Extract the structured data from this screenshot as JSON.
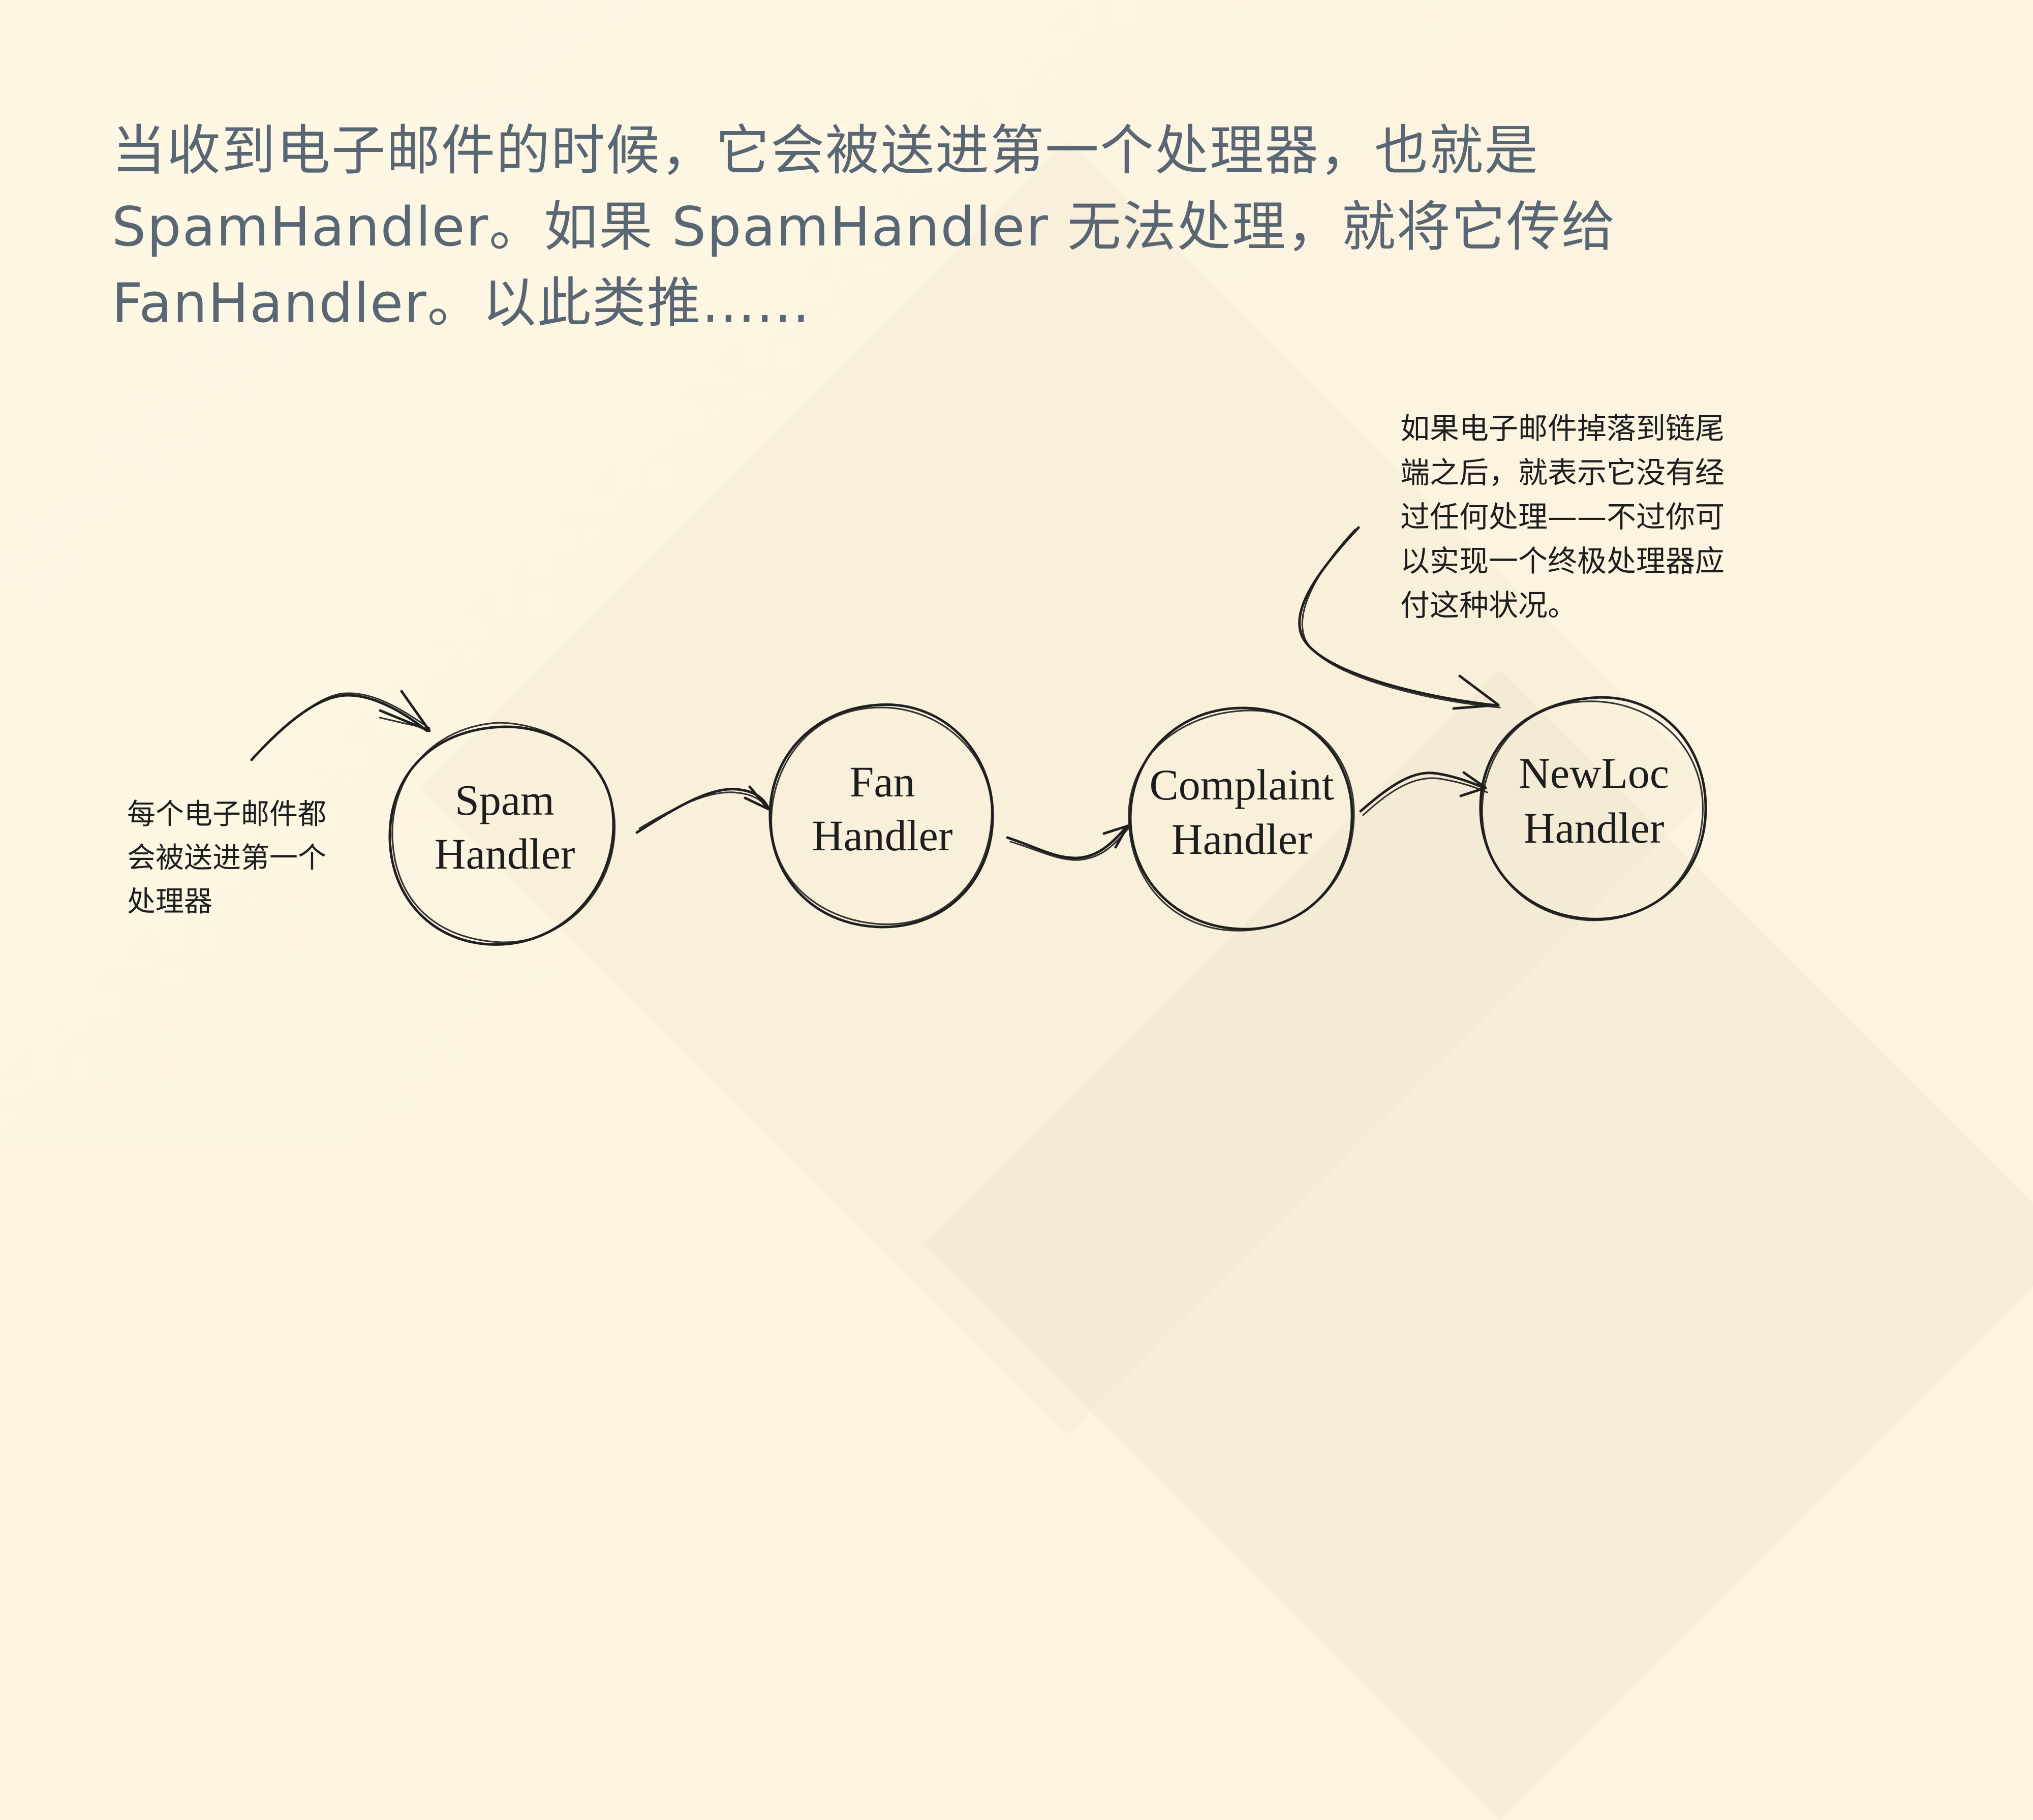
{
  "intro": {
    "line1": "当收到电子邮件的时候，它会被送进第一个处理器，也就是",
    "line2": "SpamHandler。如果 SpamHandler 无法处理，就将它传给",
    "line3": "FanHandler。以此类推......"
  },
  "nodes": [
    {
      "line1": "Spam",
      "line2": "Handler"
    },
    {
      "line1": "Fan",
      "line2": "Handler"
    },
    {
      "line1": "Complaint",
      "line2": "Handler"
    },
    {
      "line1": "NewLoc",
      "line2": "Handler"
    }
  ],
  "left_note": {
    "line1": "每个电子邮件都",
    "line2": "会被送进第一个",
    "line3": "处理器"
  },
  "right_note": {
    "line1": "如果电子邮件掉落到链尾",
    "line2": "端之后，就表示它没有经",
    "line3": "过任何处理——不过你可",
    "line4": "以实现一个终极处理器应",
    "line5": "付这种状况。"
  },
  "colors": {
    "background": "#fcf4e0",
    "headline_text": "#596674",
    "sketch_ink": "#1f1f1f"
  }
}
